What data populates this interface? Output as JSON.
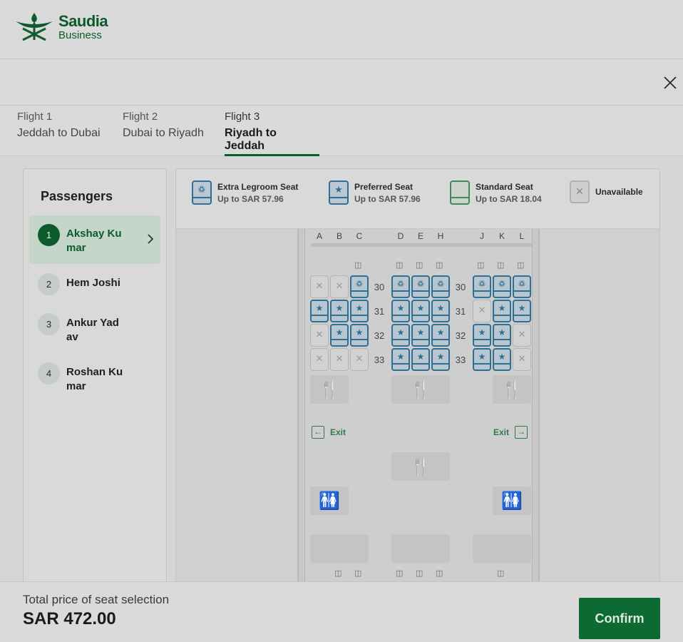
{
  "brand": {
    "name": "Saudia",
    "sub": "Business"
  },
  "tabs": [
    {
      "label": "Flight 1",
      "route": "Jeddah to Dubai"
    },
    {
      "label": "Flight 2",
      "route": "Dubai to Riyadh"
    },
    {
      "label": "Flight 3",
      "route": "Riyadh to Jeddah",
      "active": true
    }
  ],
  "passengers": {
    "title": "Passengers",
    "items": [
      {
        "num": "1",
        "name": "Akshay Kumar",
        "active": true
      },
      {
        "num": "2",
        "name": "Hem Joshi"
      },
      {
        "num": "3",
        "name": "Ankur Yadav"
      },
      {
        "num": "4",
        "name": "Roshan Kumar"
      }
    ]
  },
  "legend": [
    {
      "title": "Extra Legroom Seat",
      "price": "Up to SAR 57.96",
      "icon": "extra-legroom-icon"
    },
    {
      "title": "Preferred Seat",
      "price": "Up to SAR 57.96",
      "icon": "star-icon"
    },
    {
      "title": "Standard Seat",
      "price": "Up to SAR 18.04",
      "icon": "standard-seat-icon"
    },
    {
      "title": "Unavailable",
      "price": "",
      "icon": "x-icon"
    }
  ],
  "seatmap": {
    "columns": [
      "A",
      "B",
      "C",
      "D",
      "E",
      "H",
      "J",
      "K",
      "L"
    ],
    "rows": [
      {
        "num": "30",
        "seats": [
          "x",
          "x",
          "e",
          "e",
          "e",
          "e",
          "e",
          "e",
          "e"
        ]
      },
      {
        "num": "31",
        "seats": [
          "s",
          "s",
          "s",
          "s",
          "s",
          "s",
          "x",
          "s",
          "s"
        ]
      },
      {
        "num": "32",
        "seats": [
          "x",
          "s",
          "s",
          "s",
          "s",
          "s",
          "s",
          "s",
          "x"
        ]
      },
      {
        "num": "33",
        "seats": [
          "x",
          "x",
          "x",
          "s",
          "s",
          "s",
          "s",
          "s",
          "x"
        ]
      }
    ],
    "exit_label": "Exit"
  },
  "footer": {
    "total_label": "Total price of seat selection",
    "total_value": "SAR 472.00",
    "confirm_label": "Confirm"
  },
  "colors": {
    "accent": "#0d6a33",
    "seat_blue": "#2e6f93",
    "standard_green": "#3d8c5a"
  }
}
